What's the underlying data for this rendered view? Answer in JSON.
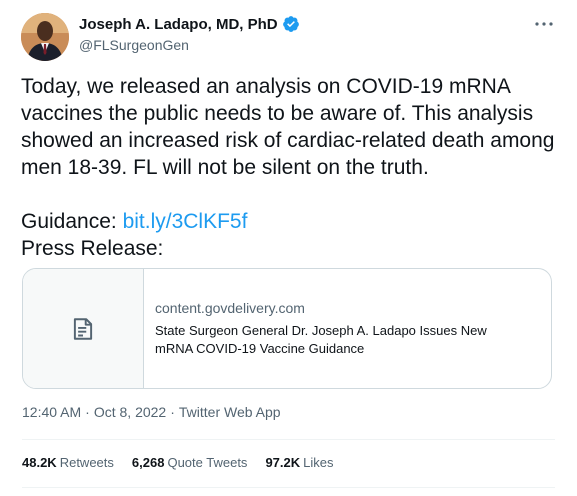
{
  "author": {
    "display_name": "Joseph A. Ladapo, MD, PhD",
    "handle": "@FLSurgeonGen",
    "verified": true,
    "avatar_icon": "profile-photo"
  },
  "tweet": {
    "line1": "Today, we released an analysis on COVID-19 mRNA vaccines the public needs to be aware of. This analysis showed an increased risk of cardiac-related death among men 18-39. FL will not be silent on the truth.",
    "guidance_label": "Guidance: ",
    "guidance_link": "bit.ly/3ClKF5f",
    "press_label": "Press Release:"
  },
  "card": {
    "domain": "content.govdelivery.com",
    "title": "State Surgeon General Dr. Joseph A. Ladapo Issues New mRNA COVID-19 Vaccine Guidance",
    "thumb_icon": "document-icon"
  },
  "meta": {
    "time": "12:40 AM",
    "separator": "·",
    "date": "Oct 8, 2022",
    "source": "Twitter Web App"
  },
  "stats": {
    "retweets_count": "48.2K",
    "retweets_label": "Retweets",
    "quotes_count": "6,268",
    "quotes_label": "Quote Tweets",
    "likes_count": "97.2K",
    "likes_label": "Likes"
  },
  "colors": {
    "accent": "#1d9bf0",
    "text": "#0f1419",
    "secondary": "#536471",
    "border": "#cfd9de"
  }
}
